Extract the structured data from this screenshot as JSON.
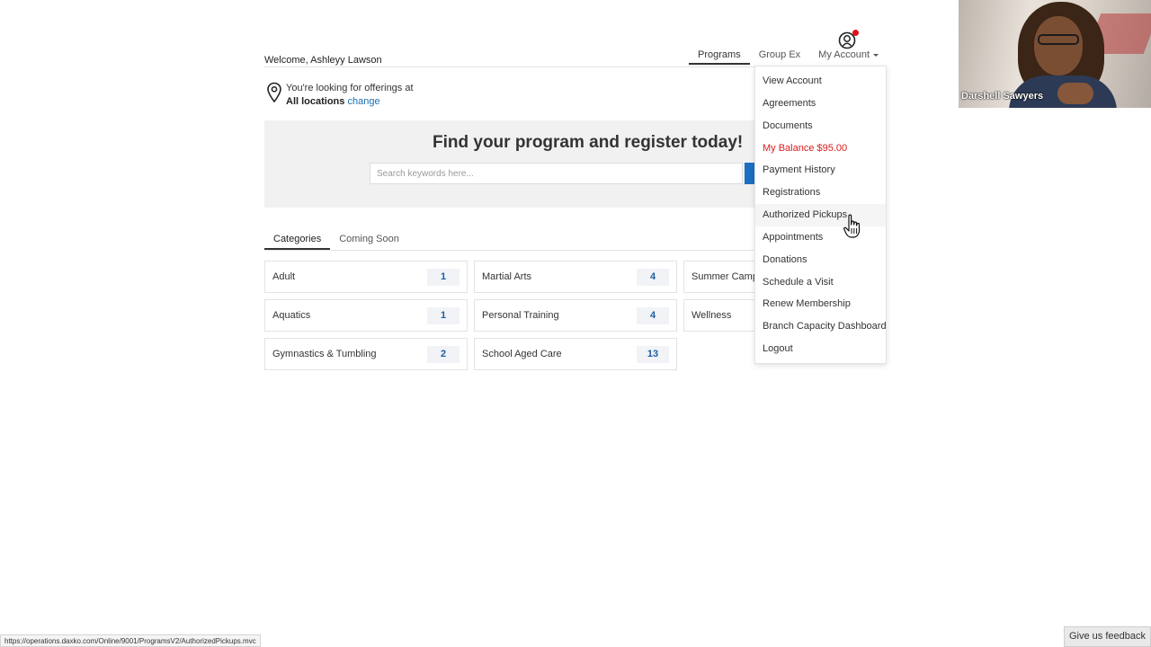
{
  "header": {
    "welcome": "Welcome, Ashleyy Lawson",
    "nav": [
      "Programs",
      "Group Ex",
      "My Account"
    ],
    "account_icon": "user-circle-icon"
  },
  "location": {
    "line1": "You're looking for offerings at",
    "bold": "All locations",
    "change": "change",
    "icon": "map-pin-icon"
  },
  "hero": {
    "title": "Find your program and register today!",
    "search_placeholder": "Search keywords here..."
  },
  "tabs": [
    "Categories",
    "Coming Soon"
  ],
  "categories": [
    {
      "name": "Adult",
      "count": "1"
    },
    {
      "name": "Martial Arts",
      "count": "4"
    },
    {
      "name": "Summer Camp",
      "count": ""
    },
    {
      "name": "Aquatics",
      "count": "1"
    },
    {
      "name": "Personal Training",
      "count": "4"
    },
    {
      "name": "Wellness",
      "count": ""
    },
    {
      "name": "Gymnastics & Tumbling",
      "count": "2"
    },
    {
      "name": "School Aged Care",
      "count": "13"
    }
  ],
  "account_menu": [
    "View Account",
    "Agreements",
    "Documents",
    "My Balance $95.00",
    "Payment History",
    "Registrations",
    "Authorized Pickups",
    "Appointments",
    "Donations",
    "Schedule a Visit",
    "Renew Membership",
    "Branch Capacity Dashboard",
    "Logout"
  ],
  "video": {
    "participant": "Darshell Sawyers"
  },
  "status_url": "https://operations.daxko.com/Online/9001/ProgramsV2/AuthorizedPickups.mvc",
  "feedback": "Give us feedback",
  "colors": {
    "accent": "#1d6fc1",
    "balance": "#d91d1d",
    "notification": "#e0101c"
  }
}
